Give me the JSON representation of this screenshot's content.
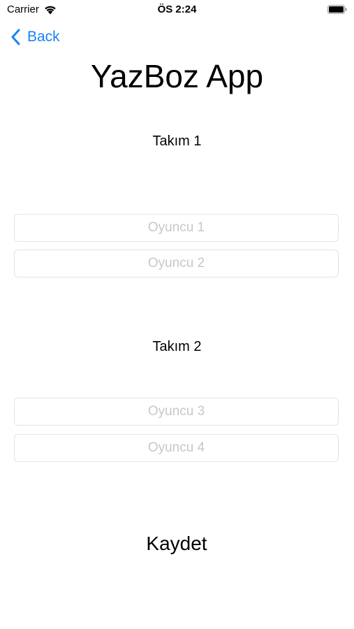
{
  "status_bar": {
    "carrier": "Carrier",
    "time": "ÖS 2:24",
    "icons": [
      "wifi-icon",
      "battery-icon"
    ]
  },
  "nav": {
    "back_label": "Back",
    "back_icon": "chevron-left-icon",
    "accent_color": "#1a82f7"
  },
  "title": "YazBoz App",
  "team1": {
    "label": "Takım 1",
    "players": [
      {
        "placeholder": "Oyuncu 1",
        "value": ""
      },
      {
        "placeholder": "Oyuncu 2",
        "value": ""
      }
    ]
  },
  "team2": {
    "label": "Takım 2",
    "players": [
      {
        "placeholder": "Oyuncu 3",
        "value": ""
      },
      {
        "placeholder": "Oyuncu 4",
        "value": ""
      }
    ]
  },
  "save_label": "Kaydet"
}
